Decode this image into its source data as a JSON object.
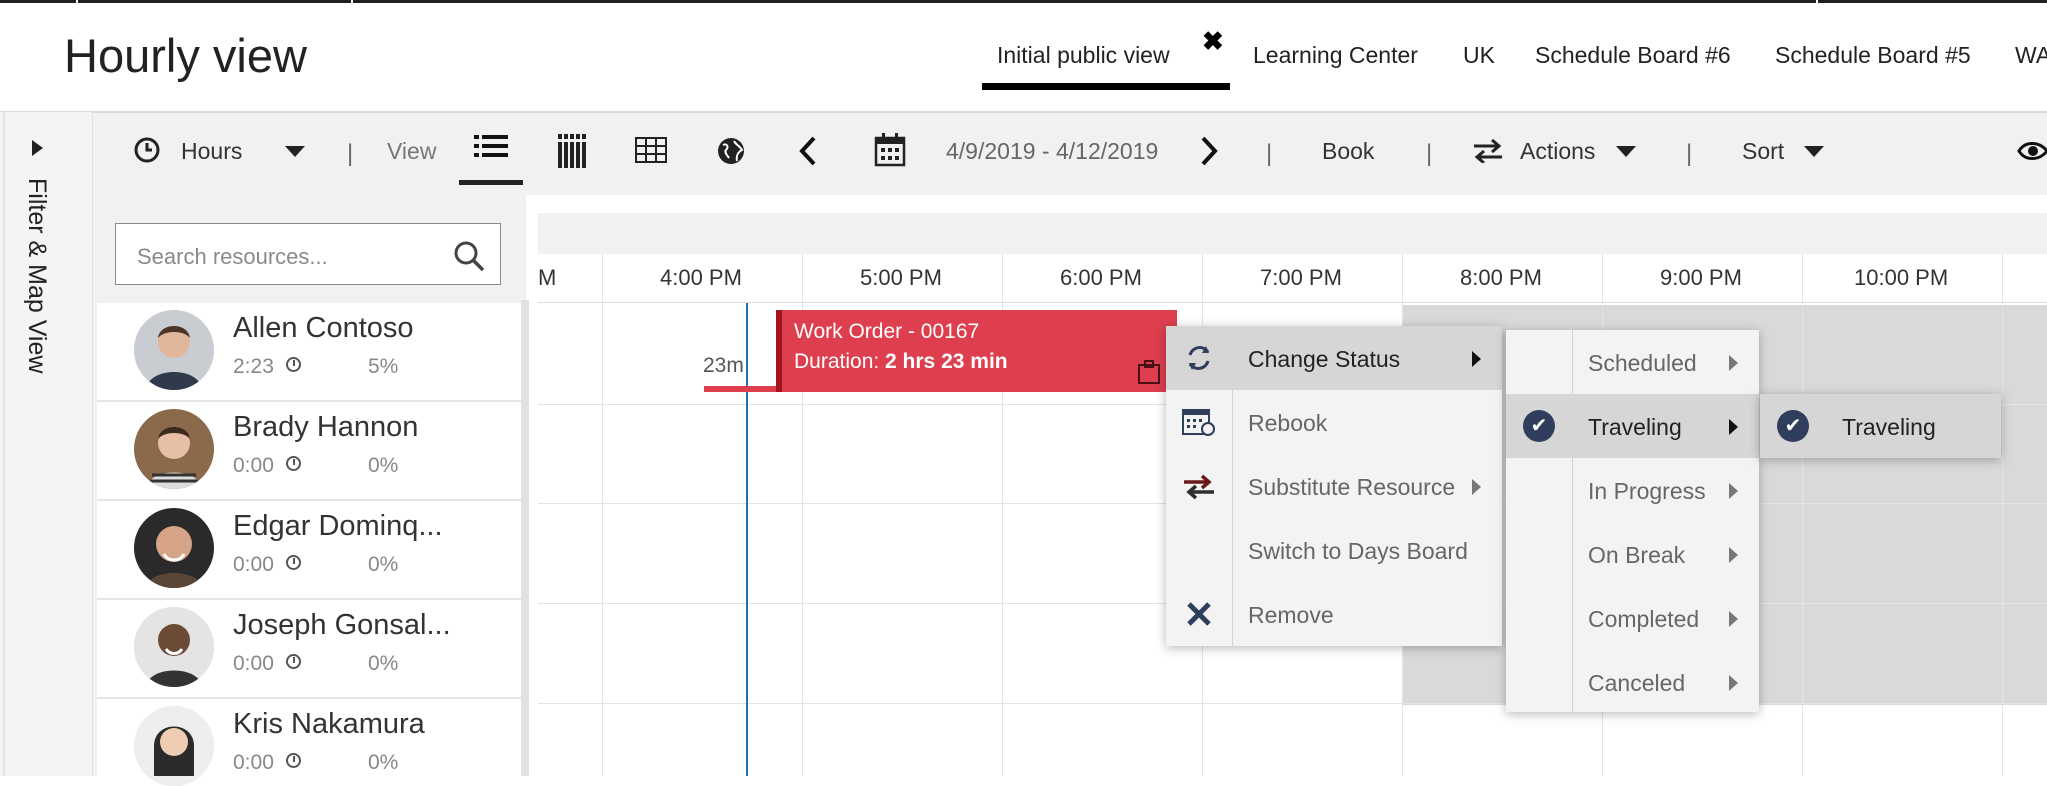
{
  "header": {
    "title": "Hourly view",
    "tabs": [
      {
        "label": "Initial public view",
        "active": true
      },
      {
        "label": "Learning Center"
      },
      {
        "label": "UK"
      },
      {
        "label": "Schedule Board #6"
      },
      {
        "label": "Schedule Board #5"
      },
      {
        "label": "WA"
      }
    ],
    "close_glyph": "✖"
  },
  "left_panel": {
    "label": "Filter & Map View"
  },
  "toolbar": {
    "hours_label": "Hours",
    "view_label": "View",
    "date_range": "4/9/2019 - 4/12/2019",
    "book_label": "Book",
    "actions_label": "Actions",
    "sort_label": "Sort",
    "separator": "|"
  },
  "search": {
    "placeholder": "Search resources..."
  },
  "resources": [
    {
      "name": "Allen Contoso",
      "time": "2:23",
      "utilization": "5%"
    },
    {
      "name": "Brady Hannon",
      "time": "0:00",
      "utilization": "0%"
    },
    {
      "name": "Edgar Dominq...",
      "time": "0:00",
      "utilization": "0%"
    },
    {
      "name": "Joseph Gonsal...",
      "time": "0:00",
      "utilization": "0%"
    },
    {
      "name": "Kris Nakamura",
      "time": "0:00",
      "utilization": "0%"
    }
  ],
  "timeline": {
    "partial_label": "M",
    "hours": [
      "4:00 PM",
      "5:00 PM",
      "6:00 PM",
      "7:00 PM",
      "8:00 PM",
      "9:00 PM",
      "10:00 PM"
    ]
  },
  "booking": {
    "title": "Work Order - 00167",
    "duration_prefix": "Duration: ",
    "duration_value": "2 hrs 23 min",
    "travel_label": "23m",
    "color": "#dd3f4f"
  },
  "context_menu": {
    "items": [
      {
        "label": "Change Status",
        "icon": "refresh-icon",
        "has_submenu": true,
        "highlighted": true
      },
      {
        "label": "Rebook",
        "icon": "calendar-rebook-icon"
      },
      {
        "label": "Substitute Resource",
        "icon": "swap-icon",
        "has_submenu": true
      },
      {
        "label": "Switch to Days Board"
      },
      {
        "label": "Remove",
        "icon": "close-icon"
      }
    ]
  },
  "status_menu": {
    "items": [
      {
        "label": "Scheduled",
        "checked": false
      },
      {
        "label": "Traveling",
        "checked": true
      },
      {
        "label": "In Progress",
        "checked": false
      },
      {
        "label": "On Break",
        "checked": false
      },
      {
        "label": "Completed",
        "checked": false
      },
      {
        "label": "Canceled",
        "checked": false
      }
    ]
  },
  "sub_status_menu": {
    "items": [
      {
        "label": "Traveling",
        "checked": true
      }
    ]
  },
  "colors": {
    "accent_dark": "#2e3e5c",
    "booking_red": "#dd3f4f",
    "now_line": "#1e6fb5",
    "offhours_gray": "#d9d9d9"
  }
}
